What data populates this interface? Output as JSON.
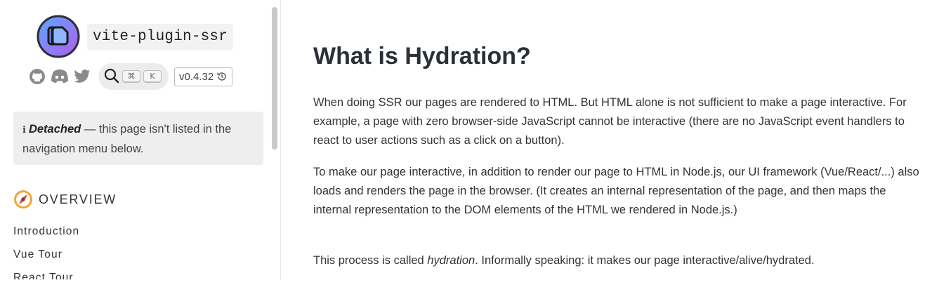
{
  "sidebar": {
    "brand": {
      "name": "vite-plugin-ssr"
    },
    "social": {
      "github": "github-icon",
      "discord": "discord-icon",
      "twitter": "twitter-icon"
    },
    "search": {
      "icon": "search-icon",
      "kbd_modifier": "⌘",
      "kbd_key": "K"
    },
    "version": {
      "label": "v0.4.32",
      "icon": "history-icon"
    },
    "detached_notice": {
      "info": "i",
      "emphasis": "Detached",
      "text": " — this page isn't listed in the navigation menu below."
    },
    "section": {
      "icon": "compass-icon",
      "title": "OVERVIEW"
    },
    "nav_items": [
      "Introduction",
      "Vue Tour",
      "React Tour"
    ]
  },
  "main": {
    "title": "What is Hydration?",
    "paragraphs": {
      "p1": "When doing SSR our pages are rendered to HTML. But HTML alone is not sufficient to make a page interactive. For example, a page with zero browser-side JavaScript cannot be interactive (there are no JavaScript event handlers to react to user actions such as a click on a button).",
      "p2": "To make our page interactive, in addition to render our page to HTML in Node.js, our UI framework (Vue/React/...) also loads and renders the page in the browser. (It creates an internal representation of the page, and then maps the internal representation to the DOM elements of the HTML we rendered in Node.js.)",
      "p3_before": "This process is called ",
      "p3_em": "hydration",
      "p3_after": ". Informally speaking: it makes our page interactive/alive/hydrated."
    }
  },
  "colors": {
    "logo_gradient_start": "#5aa8ff",
    "logo_gradient_end": "#b45cf0",
    "text": "#333333",
    "panel": "#eeeeee"
  }
}
